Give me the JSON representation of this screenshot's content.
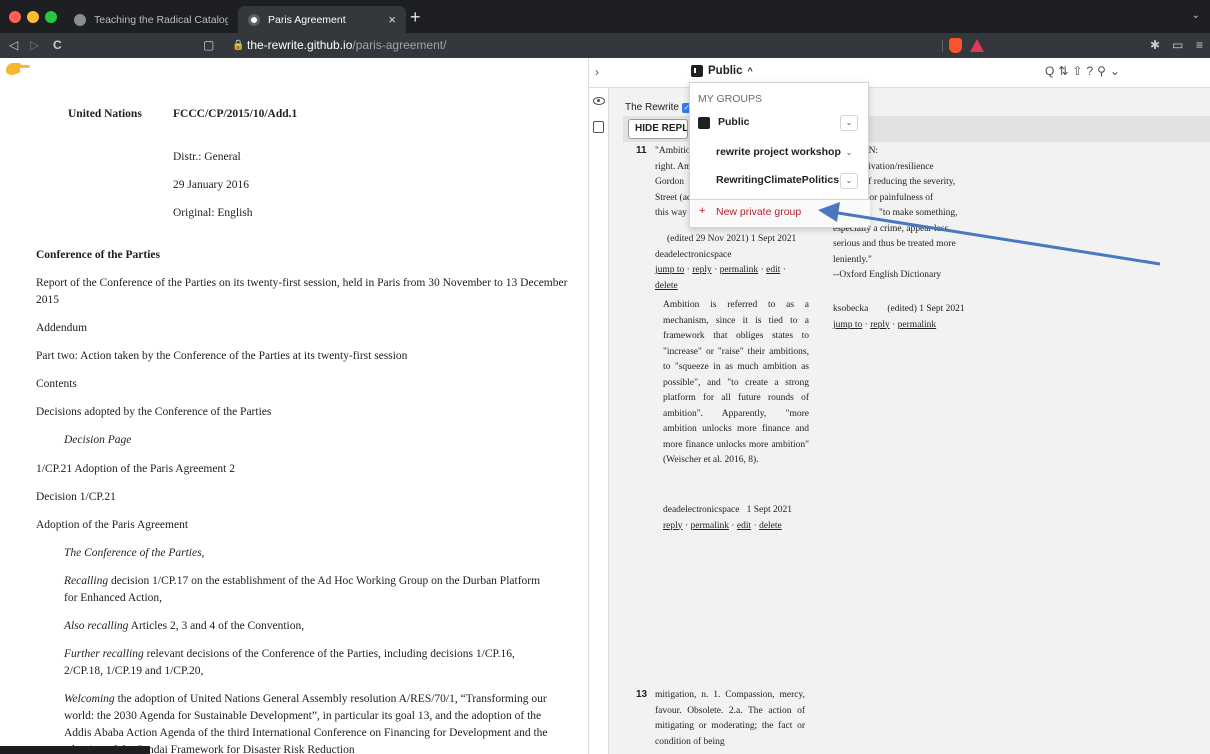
{
  "browser": {
    "tabs": [
      {
        "title": "Teaching the Radical Catalogue – C"
      },
      {
        "title": "Paris Agreement",
        "close": "×"
      }
    ],
    "new_tab": "+",
    "url": {
      "host": "the-rewrite.github.io",
      "path": "/paris-agreement/"
    },
    "icons": {
      "back": "◁",
      "forward": "▷",
      "reload": "C",
      "bookmark": "▢",
      "lock": "🔒",
      "extensions": "✱",
      "sidebar": "▭",
      "menu": "≡",
      "tab_list": "⌄"
    }
  },
  "document": {
    "org": "United Nations",
    "symbol": "FCCC/CP/2015/10/Add.1",
    "distr": "Distr.: General",
    "date": "29 January 2016",
    "original": "Original: English",
    "body_title": "Conference of the Parties",
    "report": "Report of the Conference of the Parties on its twenty-first session, held in Paris from 30 November to 13 December",
    "report_year": "2015",
    "addendum": "Addendum",
    "part_two": "Part two: Action taken by the Conference of the Parties at its twenty-first session",
    "contents": "Contents",
    "decisions": "Decisions adopted by the Conference of the Parties",
    "decision_page": "Decision Page",
    "cp21": "1/CP.21 Adoption of the Paris Agreement 2",
    "decision_num": "Decision 1/CP.21",
    "adoption": "Adoption of the Paris Agreement",
    "conference": "The Conference of the Parties,",
    "recalling_em": "Recalling",
    "recalling_1": " decision 1/CP.17 on the establishment of the Ad Hoc Working Group on the Durban Platform",
    "recalling_2": "for Enhanced Action,",
    "also_em": "Also recalling",
    "also_rest": " Articles 2, 3 and 4 of the Convention,",
    "further_em": "Further recalling",
    "further_1": " relevant decisions of the Conference of the Parties, including decisions 1/CP.16,",
    "further_2": "2/CP.18, 1/CP.19 and 1/CP.20,",
    "welcoming_em": "Welcoming",
    "welcoming_1": " the adoption of United Nations General Assembly resolution A/RES/70/1, “Transforming our",
    "welcoming_2": "world: the 2030 Agenda for Sustainable Development”, in particular its goal 13, and the adoption of the",
    "welcoming_3": "Addis Ababa Action Agenda of the third International Conference on Financing for Development and the",
    "welcoming_4": "adoption of the Sendai Framework for Disaster Risk Reduction"
  },
  "sidebar": {
    "collapse": "›",
    "group_button": "Public",
    "group_caret": "^",
    "tools": "Q⇅⇧?⚲⌄",
    "filter_label": "The Rewrite",
    "check": "✓",
    "hide_replies": "HIDE REPLIES",
    "dropdown": {
      "header": "MY GROUPS",
      "groups": [
        {
          "name": "Public",
          "expand": "⌄"
        },
        {
          "name": "rewrite project workshop",
          "expand": "⌄"
        },
        {
          "name": "RewritingClimatePolitics",
          "expand": "⌄"
        }
      ],
      "new_group_plus": "+",
      "new_group": "New private group"
    },
    "annotation_11": {
      "number": "11",
      "lines": [
        "\"Ambitio",
        "right. Am",
        "Gordon",
        "Street (ac",
        "this way t"
      ],
      "meta": "(edited 29 Nov 2021) 1 Sept 2021",
      "user": "deadelectronicspace",
      "jump_to": "jump to",
      "reply": "reply",
      "permalink": "permalink",
      "edit": "edit",
      "delete": "delete",
      "reply_body": "Ambition is referred to as a mechanism, since it is tied to a framework that obliges states to \"increase\" or \"raise\" their ambitions, to \"squeeze in as much ambition as possible\", and \"to create a strong platform for all future rounds of ambition\". Apparently, \"more ambition unlocks more finance and more finance unlocks more ambition\" (Weischer et al. 2016, 8).",
      "reply_user": "deadelectronicspace",
      "reply_date": "1 Sept 2021"
    },
    "annotation_right": {
      "lines": [
        "ATION:",
        "ce/derivation/resilience",
        "ion of reducing the severity,",
        "ess, or painfulness of",
        "\"to make something,",
        "especially a crime, appear less",
        "serious and thus be treated more",
        "leniently.\""
      ],
      "source": "--Oxford English Dictionary",
      "user": "ksobecka",
      "meta": "(edited) 1 Sept 2021",
      "jump_to": "jump to",
      "reply": "reply",
      "permalink": "permalink"
    },
    "annotation_13": {
      "number": "13",
      "body": "mitigation, n. 1. Compassion, mercy, favour. Obsolete. 2.a. The action of mitigating or moderating; the fact or condition of being"
    }
  }
}
